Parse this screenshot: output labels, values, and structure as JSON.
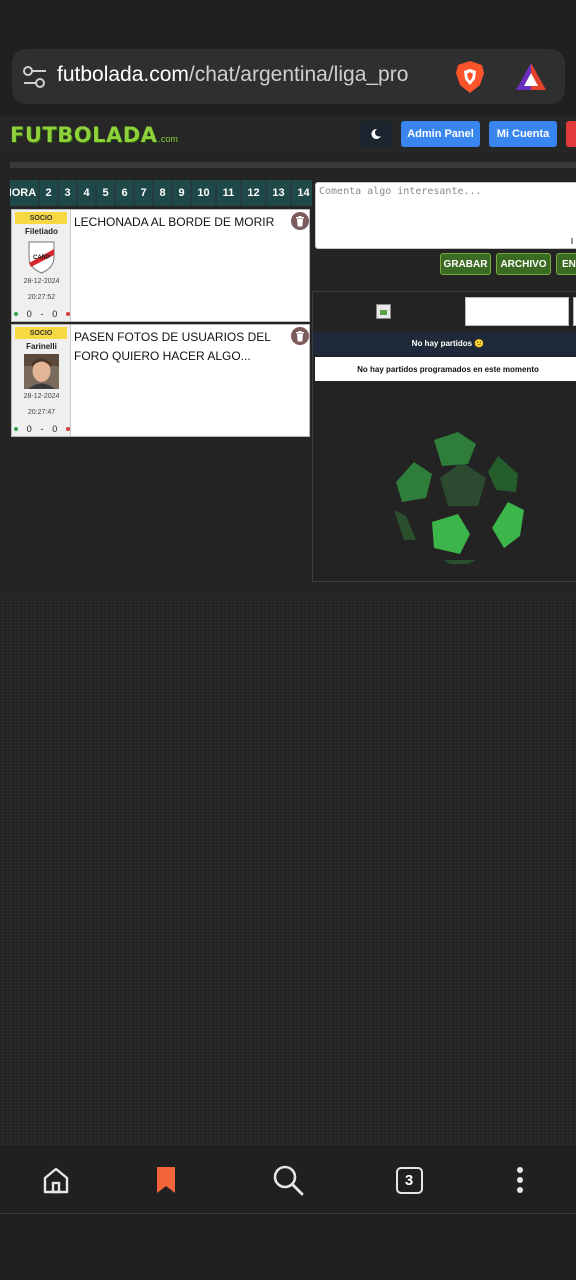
{
  "browser": {
    "url_domain": "futbolada.com",
    "url_path": "/chat/argentina/liga_pro",
    "icons": [
      "site-settings-icon",
      "brave-shields-icon",
      "brave-rewards-icon"
    ]
  },
  "header": {
    "logo_text": "FUTBOLADA",
    "logo_suffix": ".com",
    "theme_toggle_icon": "moon-icon",
    "admin_label": "Admin Panel",
    "account_label": "Mi Cuenta"
  },
  "tabs": [
    "HORA",
    "2",
    "3",
    "4",
    "5",
    "6",
    "7",
    "8",
    "9",
    "10",
    "11",
    "12",
    "13",
    "14"
  ],
  "posts": [
    {
      "badge": "SOCIO",
      "username": "Filetiado",
      "date": "28-12-2024",
      "time": "20:27:52",
      "votes_up": "0",
      "separator": "-",
      "votes_down": "0",
      "text": "LECHONADA AL BORDE DE MORIR"
    },
    {
      "badge": "SOCIO",
      "username": "Farinelli",
      "date": "28-12-2024",
      "time": "20:27:47",
      "votes_up": "0",
      "separator": "-",
      "votes_down": "0",
      "text": "PASEN FOTOS DE USUARIOS DEL FORO QUIERO HACER ALGO..."
    }
  ],
  "composer": {
    "placeholder": "Comenta algo interesante...",
    "record_label": "GRABAR",
    "file_label": "ARCHIVO",
    "send_label": "ENVIAR"
  },
  "matches": {
    "header": "No hay partidos 😕",
    "message": "No hay partidos programados en este momento"
  },
  "bottom_nav": {
    "items": [
      "home-icon",
      "bookmarks-icon",
      "search-icon",
      "tabs-icon",
      "menu-icon"
    ],
    "tab_count": "3"
  },
  "colors": {
    "accent_blue": "#3a86f0",
    "logo_green": "#8ed13a",
    "button_green": "#3b6a22",
    "tab_teal": "#1f4848",
    "badge_yellow": "#f5d842",
    "bookmark_orange": "#f2653a"
  }
}
